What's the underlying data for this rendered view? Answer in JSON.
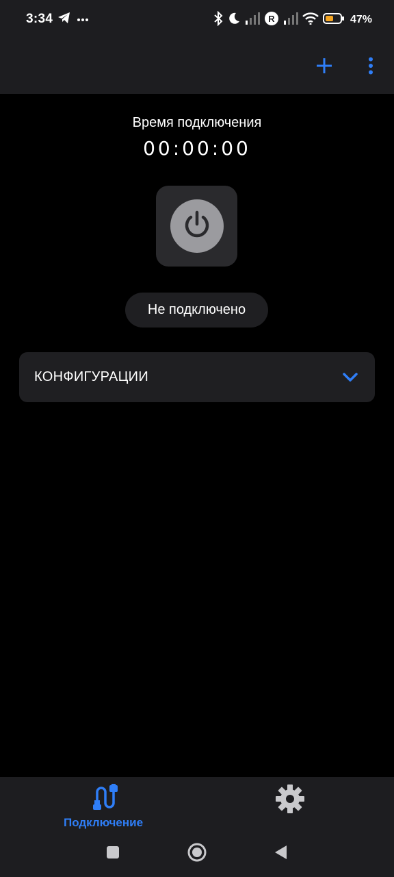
{
  "status_bar": {
    "time": "3:34",
    "battery_percent": "47%",
    "icons": [
      "telegram-icon",
      "more-notifications-icon",
      "bluetooth-icon",
      "do-not-disturb-icon",
      "signal-icon",
      "roaming-icon",
      "wifi-icon",
      "battery-icon"
    ],
    "battery_color": "#f5a623"
  },
  "app_bar": {
    "add_icon": "plus-icon",
    "menu_icon": "more-vert-icon",
    "accent_color": "#2f7ef7"
  },
  "main": {
    "timer_label": "Время подключения",
    "timer_value": "00:00:00",
    "power_icon": "power-icon",
    "connection_status": "Не подключено",
    "config_section": {
      "title": "КОНФИГУРАЦИИ",
      "icon": "chevron-down-icon"
    }
  },
  "bottom_nav": {
    "items": [
      {
        "label": "Подключение",
        "icon": "connection-icon",
        "active": true
      },
      {
        "label": "",
        "icon": "gear-icon",
        "active": false
      }
    ]
  },
  "system_nav": {
    "buttons": [
      "recents-icon",
      "home-icon",
      "back-icon"
    ]
  }
}
